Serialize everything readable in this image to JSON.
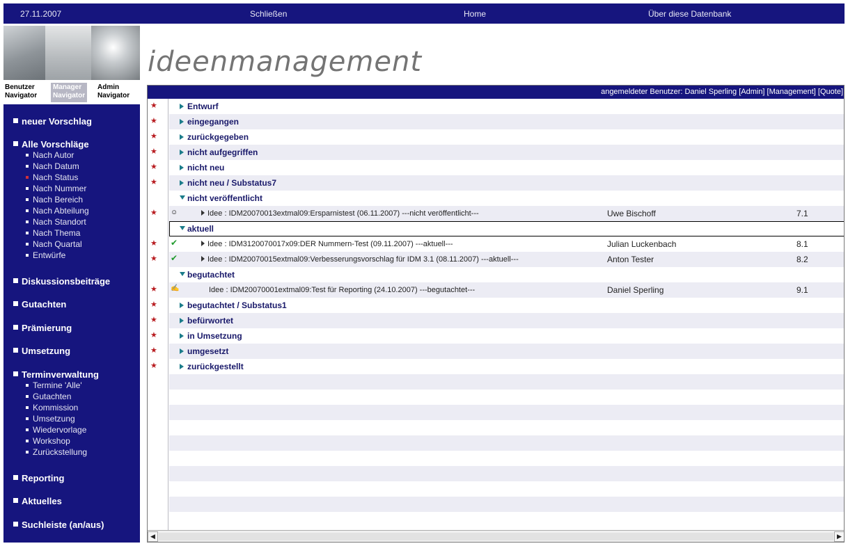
{
  "topbar": {
    "date": "27.11.2007",
    "close": "Schließen",
    "home": "Home",
    "about": "Über diese Datenbank"
  },
  "brand": "ideenmanagement",
  "navigator_tabs": [
    {
      "line1": "Benutzer",
      "line2": "Navigator"
    },
    {
      "line1": "Manager",
      "line2": "Navigator"
    },
    {
      "line1": "Admin",
      "line2": "Navigator"
    }
  ],
  "sidebar": {
    "new_proposal": "neuer Vorschlag",
    "all_proposals": "Alle Vorschläge",
    "proposal_subs": [
      "Nach Autor",
      "Nach Datum",
      "Nach Status",
      "Nach Nummer",
      "Nach Bereich",
      "Nach Abteilung",
      "Nach Standort",
      "Nach Thema",
      "Nach Quartal",
      "Entwürfe"
    ],
    "discussion": "Diskussionsbeiträge",
    "expertise": "Gutachten",
    "award": "Prämierung",
    "implementation": "Umsetzung",
    "dates": "Terminverwaltung",
    "date_subs": [
      "Termine 'Alle'",
      "Gutachten",
      "Kommission",
      "Umsetzung",
      "Wiedervorlage",
      "Workshop",
      "Zurückstellung"
    ],
    "reporting": "Reporting",
    "news": "Aktuelles",
    "searchbar": "Suchleiste (an/aus)"
  },
  "userbar": "angemeldeter Benutzer: Daniel Sperling [Admin] [Management] [Quote]",
  "groups": {
    "g0": "Entwurf",
    "g1": "eingegangen",
    "g2": "zurückgegeben",
    "g3": "nicht aufgegriffen",
    "g4": "nicht neu",
    "g5": "nicht neu / Substatus7",
    "g6": "nicht veröffentlicht",
    "g7": "aktuell",
    "g8": "begutachtet",
    "g9": "begutachtet / Substatus1",
    "g10": "befürwortet",
    "g11": "in Umsetzung",
    "g12": "umgesetzt",
    "g13": "zurückgestellt"
  },
  "items": [
    {
      "text": "Idee : IDM20070013extmal09:Ersparnistest (06.11.2007) ---nicht veröffentlicht---",
      "author": "Uwe Bischoff",
      "num": "7.1"
    },
    {
      "text": "Idee : IDM3120070017x09:DER Nummern-Test (09.11.2007) ---aktuell---",
      "author": "Julian Luckenbach",
      "num": "8.1"
    },
    {
      "text": "Idee : IDM20070015extmal09:Verbesserungsvorschlag für IDM 3.1 (08.11.2007) ---aktuell---",
      "author": "Anton Tester",
      "num": "8.2"
    },
    {
      "text": "Idee : IDM20070001extmal09:Test für Reporting (24.10.2007) ---begutachtet---",
      "author": "Daniel Sperling",
      "num": "9.1"
    }
  ],
  "colors": {
    "navy": "#16157e",
    "rowAlt": "#ececf4",
    "star": "#b81c20",
    "check": "#1f9a2c"
  }
}
